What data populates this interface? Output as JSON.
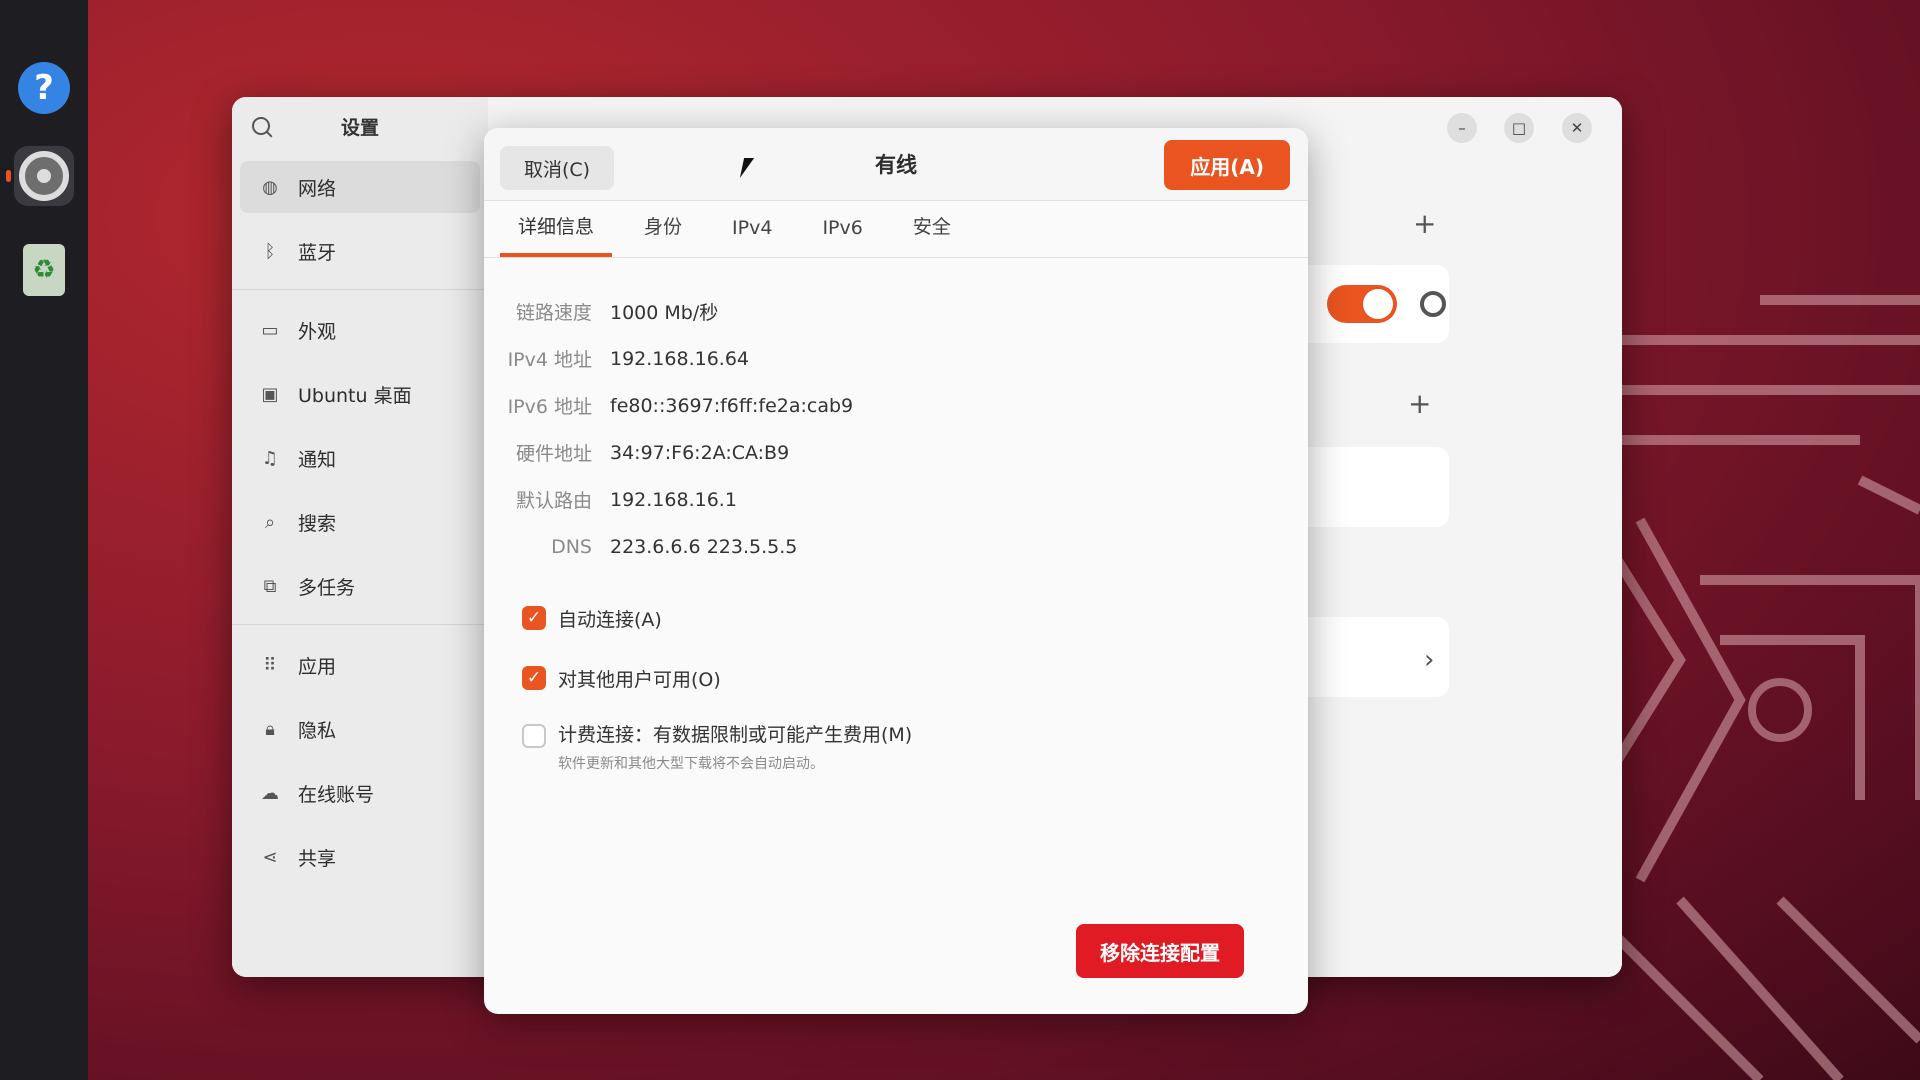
{
  "dock": {
    "items": [
      {
        "name": "help",
        "icon": "help-icon"
      },
      {
        "name": "settings",
        "icon": "settings-icon"
      },
      {
        "name": "trash",
        "icon": "trash-icon"
      }
    ]
  },
  "settings_window": {
    "sidebar": {
      "title": "设置",
      "items": [
        {
          "label": "网络",
          "icon": "network-icon",
          "active": true
        },
        {
          "label": "蓝牙",
          "icon": "bluetooth-icon"
        },
        {
          "label": "外观",
          "icon": "appearance-icon"
        },
        {
          "label": "Ubuntu 桌面",
          "icon": "desktop-icon"
        },
        {
          "label": "通知",
          "icon": "bell-icon"
        },
        {
          "label": "搜索",
          "icon": "search-icon"
        },
        {
          "label": "多任务",
          "icon": "multitask-icon"
        },
        {
          "label": "应用",
          "icon": "apps-grid-icon"
        },
        {
          "label": "隐私",
          "icon": "lock-icon"
        },
        {
          "label": "在线账号",
          "icon": "cloud-icon"
        },
        {
          "label": "共享",
          "icon": "share-icon"
        }
      ]
    },
    "wired_toggle_on": true
  },
  "dialog": {
    "title": "有线",
    "cancel_label": "取消(C)",
    "apply_label": "应用(A)",
    "tabs": [
      "详细信息",
      "身份",
      "IPv4",
      "IPv6",
      "安全"
    ],
    "active_tab": "详细信息",
    "details": [
      {
        "label": "链路速度",
        "value": "1000 Mb/秒"
      },
      {
        "label": "IPv4 地址",
        "value": "192.168.16.64"
      },
      {
        "label": "IPv6 地址",
        "value": "fe80::3697:f6ff:fe2a:cab9"
      },
      {
        "label": "硬件地址",
        "value": "34:97:F6:2A:CA:B9"
      },
      {
        "label": "默认路由",
        "value": "192.168.16.1"
      },
      {
        "label": "DNS",
        "value": "223.6.6.6 223.5.5.5"
      }
    ],
    "checks": {
      "auto_connect": {
        "label": "自动连接(A)",
        "checked": true
      },
      "all_users": {
        "label": "对其他用户可用(O)",
        "checked": true
      },
      "metered": {
        "label": "计费连接：有数据限制或可能产生费用(M)",
        "sublabel": "软件更新和其他大型下载将不会自动启动。",
        "checked": false
      }
    },
    "remove_label": "移除连接配置"
  },
  "colors": {
    "accent": "#e95420",
    "destructive": "#e01b24"
  }
}
